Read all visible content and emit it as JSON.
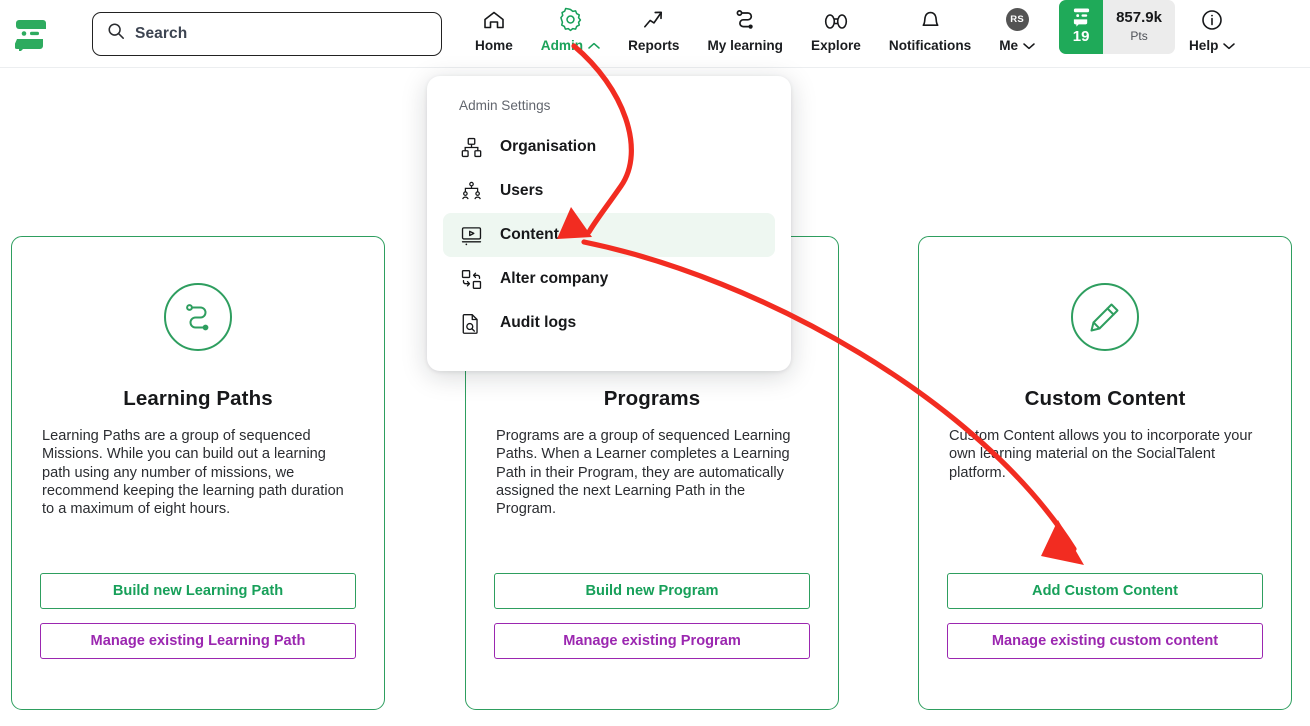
{
  "brand": {
    "name": "socialtalent-logo"
  },
  "search": {
    "placeholder": "Search",
    "value": "",
    "icon": "search-icon"
  },
  "nav": {
    "items": [
      {
        "label": "Home",
        "icon": "home-icon",
        "active": false,
        "caret": ""
      },
      {
        "label": "Admin",
        "icon": "gear-icon",
        "active": true,
        "caret": "⌃"
      },
      {
        "label": "Reports",
        "icon": "trending-up-icon",
        "active": false,
        "caret": ""
      },
      {
        "label": "My learning",
        "icon": "path-icon",
        "active": false,
        "caret": ""
      },
      {
        "label": "Explore",
        "icon": "binoculars-icon",
        "active": false,
        "caret": ""
      },
      {
        "label": "Notifications",
        "icon": "bell-icon",
        "active": false,
        "caret": ""
      },
      {
        "label": "Me",
        "icon": "avatar-icon",
        "active": false,
        "caret": "⌄"
      },
      {
        "label": "Help",
        "icon": "info-icon",
        "active": false,
        "caret": "⌄"
      }
    ],
    "avatar_initials": "RS",
    "points": {
      "level": "19",
      "value": "857.9k",
      "unit": "Pts"
    }
  },
  "dropdown": {
    "title": "Admin Settings",
    "items": [
      {
        "label": "Organisation",
        "icon": "org-chart-icon",
        "selected": false
      },
      {
        "label": "Users",
        "icon": "users-tree-icon",
        "selected": false
      },
      {
        "label": "Content",
        "icon": "video-monitor-icon",
        "selected": true
      },
      {
        "label": "Alter company",
        "icon": "swap-company-icon",
        "selected": false
      },
      {
        "label": "Audit logs",
        "icon": "doc-search-icon",
        "selected": false
      }
    ]
  },
  "cards": [
    {
      "title": "Learning Paths",
      "icon": "learning-path-icon",
      "description": "Learning Paths are a group of sequenced Missions. While you can build out a learning path using any number of missions, we recommend keeping the learning path duration to a maximum of eight hours.",
      "primary_label": "Build new Learning Path",
      "secondary_label": "Manage existing Learning Path"
    },
    {
      "title": "Programs",
      "icon": "programs-icon",
      "description": "Programs are a group of sequenced Learning Paths. When a Learner completes a Learning Path in their Program, they are automatically assigned the next Learning Path in the Program.",
      "primary_label": "Build new Program",
      "secondary_label": "Manage existing Program"
    },
    {
      "title": "Custom Content",
      "icon": "pencil-icon",
      "description": "Custom Content allows you to incorporate your own learning material on the SocialTalent platform.",
      "primary_label": "Add Custom Content",
      "secondary_label": "Manage existing custom content"
    }
  ],
  "annotations": {
    "color": "#f22c21",
    "arrows": [
      {
        "name": "admin-to-content-arrow",
        "from": "Admin",
        "to": "Content"
      },
      {
        "name": "content-to-add-custom-content-arrow",
        "from": "Content",
        "to": "Add Custom Content"
      }
    ]
  },
  "colors": {
    "brand_green": "#1faa59",
    "accent_green": "#18a05a",
    "accent_purple": "#9b27b0",
    "annotation_red": "#f22c21",
    "text": "#17181a"
  }
}
